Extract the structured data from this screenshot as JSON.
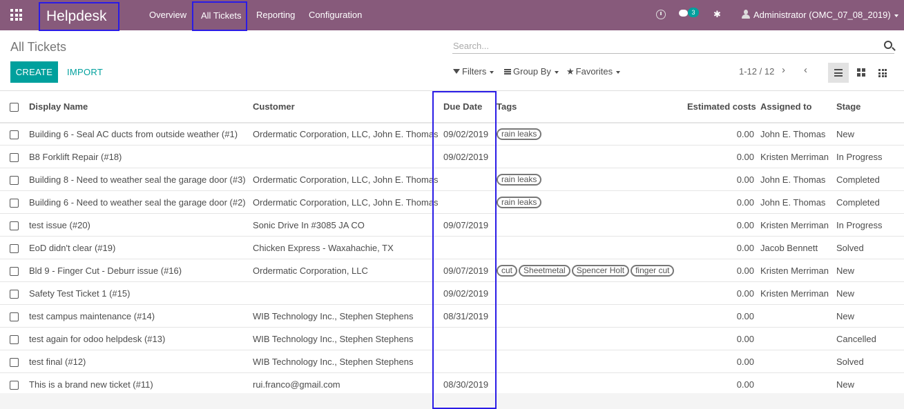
{
  "topbar": {
    "brand": "Helpdesk",
    "menu": [
      "Overview",
      "All Tickets",
      "Reporting",
      "Configuration"
    ],
    "chat_count": "3",
    "user": "Administrator (OMC_07_08_2019)",
    "bg_color": "#875a7b"
  },
  "control": {
    "title": "All Tickets",
    "search_placeholder": "Search...",
    "create_label": "CREATE",
    "import_label": "IMPORT",
    "filters_label": "Filters",
    "groupby_label": "Group By",
    "favorites_label": "Favorites",
    "pager": "1-12 / 12",
    "accent_color": "#00a09d"
  },
  "columns": [
    "Display Name",
    "Customer",
    "Due Date",
    "Tags",
    "Estimated costs",
    "Assigned to",
    "Stage"
  ],
  "rows": [
    {
      "name": "Building 6 - Seal AC ducts from outside weather (#1)",
      "customer": "Ordermatic Corporation, LLC, John E. Thomas",
      "due": "09/02/2019",
      "tags": [
        "rain leaks"
      ],
      "cost": "0.00",
      "assigned": "John E. Thomas",
      "stage": "New"
    },
    {
      "name": "B8 Forklift Repair (#18)",
      "customer": "",
      "due": "09/02/2019",
      "tags": [],
      "cost": "0.00",
      "assigned": "Kristen Merriman",
      "stage": "In Progress"
    },
    {
      "name": "Building 8 - Need to weather seal the garage door (#3)",
      "customer": "Ordermatic Corporation, LLC, John E. Thomas",
      "due": "",
      "tags": [
        "rain leaks"
      ],
      "cost": "0.00",
      "assigned": "John E. Thomas",
      "stage": "Completed"
    },
    {
      "name": "Building 6 - Need to weather seal the garage door (#2)",
      "customer": "Ordermatic Corporation, LLC, John E. Thomas",
      "due": "",
      "tags": [
        "rain leaks"
      ],
      "cost": "0.00",
      "assigned": "John E. Thomas",
      "stage": "Completed"
    },
    {
      "name": "test issue (#20)",
      "customer": "Sonic Drive In #3085 JA CO",
      "due": "09/07/2019",
      "tags": [],
      "cost": "0.00",
      "assigned": "Kristen Merriman",
      "stage": "In Progress"
    },
    {
      "name": "EoD didn't clear (#19)",
      "customer": "Chicken Express - Waxahachie, TX",
      "due": "",
      "tags": [],
      "cost": "0.00",
      "assigned": "Jacob Bennett",
      "stage": "Solved"
    },
    {
      "name": "Bld 9 - Finger Cut - Deburr issue (#16)",
      "customer": "Ordermatic Corporation, LLC",
      "due": "09/07/2019",
      "tags": [
        "cut",
        "Sheetmetal",
        "Spencer Holt",
        "finger cut"
      ],
      "cost": "0.00",
      "assigned": "Kristen Merriman",
      "stage": "New"
    },
    {
      "name": "Safety Test Ticket 1 (#15)",
      "customer": "",
      "due": "09/02/2019",
      "tags": [],
      "cost": "0.00",
      "assigned": "Kristen Merriman",
      "stage": "New"
    },
    {
      "name": "test campus maintenance (#14)",
      "customer": "WIB Technology Inc., Stephen Stephens",
      "due": "08/31/2019",
      "tags": [],
      "cost": "0.00",
      "assigned": "",
      "stage": "New"
    },
    {
      "name": "test again for odoo helpdesk (#13)",
      "customer": "WIB Technology Inc., Stephen Stephens",
      "due": "",
      "tags": [],
      "cost": "0.00",
      "assigned": "",
      "stage": "Cancelled"
    },
    {
      "name": "test final (#12)",
      "customer": "WIB Technology Inc., Stephen Stephens",
      "due": "",
      "tags": [],
      "cost": "0.00",
      "assigned": "",
      "stage": "Solved"
    },
    {
      "name": "This is a brand new ticket (#11)",
      "customer": "rui.franco@gmail.com",
      "due": "08/30/2019",
      "tags": [],
      "cost": "0.00",
      "assigned": "",
      "stage": "New"
    }
  ]
}
